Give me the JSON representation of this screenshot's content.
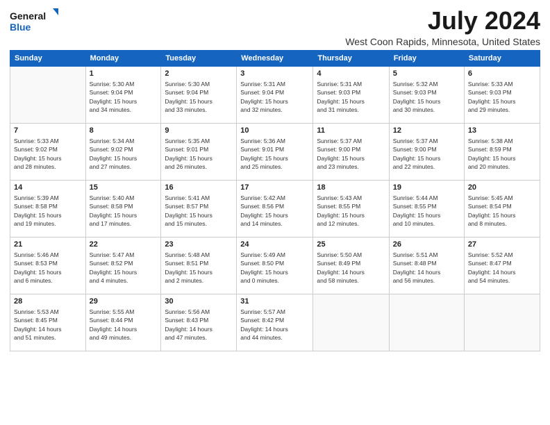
{
  "header": {
    "logo_line1": "General",
    "logo_line2": "Blue",
    "month_title": "July 2024",
    "location": "West Coon Rapids, Minnesota, United States"
  },
  "calendar": {
    "days_of_week": [
      "Sunday",
      "Monday",
      "Tuesday",
      "Wednesday",
      "Thursday",
      "Friday",
      "Saturday"
    ],
    "weeks": [
      [
        {
          "day": "",
          "info": ""
        },
        {
          "day": "1",
          "info": "Sunrise: 5:30 AM\nSunset: 9:04 PM\nDaylight: 15 hours\nand 34 minutes."
        },
        {
          "day": "2",
          "info": "Sunrise: 5:30 AM\nSunset: 9:04 PM\nDaylight: 15 hours\nand 33 minutes."
        },
        {
          "day": "3",
          "info": "Sunrise: 5:31 AM\nSunset: 9:04 PM\nDaylight: 15 hours\nand 32 minutes."
        },
        {
          "day": "4",
          "info": "Sunrise: 5:31 AM\nSunset: 9:03 PM\nDaylight: 15 hours\nand 31 minutes."
        },
        {
          "day": "5",
          "info": "Sunrise: 5:32 AM\nSunset: 9:03 PM\nDaylight: 15 hours\nand 30 minutes."
        },
        {
          "day": "6",
          "info": "Sunrise: 5:33 AM\nSunset: 9:03 PM\nDaylight: 15 hours\nand 29 minutes."
        }
      ],
      [
        {
          "day": "7",
          "info": "Sunrise: 5:33 AM\nSunset: 9:02 PM\nDaylight: 15 hours\nand 28 minutes."
        },
        {
          "day": "8",
          "info": "Sunrise: 5:34 AM\nSunset: 9:02 PM\nDaylight: 15 hours\nand 27 minutes."
        },
        {
          "day": "9",
          "info": "Sunrise: 5:35 AM\nSunset: 9:01 PM\nDaylight: 15 hours\nand 26 minutes."
        },
        {
          "day": "10",
          "info": "Sunrise: 5:36 AM\nSunset: 9:01 PM\nDaylight: 15 hours\nand 25 minutes."
        },
        {
          "day": "11",
          "info": "Sunrise: 5:37 AM\nSunset: 9:00 PM\nDaylight: 15 hours\nand 23 minutes."
        },
        {
          "day": "12",
          "info": "Sunrise: 5:37 AM\nSunset: 9:00 PM\nDaylight: 15 hours\nand 22 minutes."
        },
        {
          "day": "13",
          "info": "Sunrise: 5:38 AM\nSunset: 8:59 PM\nDaylight: 15 hours\nand 20 minutes."
        }
      ],
      [
        {
          "day": "14",
          "info": "Sunrise: 5:39 AM\nSunset: 8:58 PM\nDaylight: 15 hours\nand 19 minutes."
        },
        {
          "day": "15",
          "info": "Sunrise: 5:40 AM\nSunset: 8:58 PM\nDaylight: 15 hours\nand 17 minutes."
        },
        {
          "day": "16",
          "info": "Sunrise: 5:41 AM\nSunset: 8:57 PM\nDaylight: 15 hours\nand 15 minutes."
        },
        {
          "day": "17",
          "info": "Sunrise: 5:42 AM\nSunset: 8:56 PM\nDaylight: 15 hours\nand 14 minutes."
        },
        {
          "day": "18",
          "info": "Sunrise: 5:43 AM\nSunset: 8:55 PM\nDaylight: 15 hours\nand 12 minutes."
        },
        {
          "day": "19",
          "info": "Sunrise: 5:44 AM\nSunset: 8:55 PM\nDaylight: 15 hours\nand 10 minutes."
        },
        {
          "day": "20",
          "info": "Sunrise: 5:45 AM\nSunset: 8:54 PM\nDaylight: 15 hours\nand 8 minutes."
        }
      ],
      [
        {
          "day": "21",
          "info": "Sunrise: 5:46 AM\nSunset: 8:53 PM\nDaylight: 15 hours\nand 6 minutes."
        },
        {
          "day": "22",
          "info": "Sunrise: 5:47 AM\nSunset: 8:52 PM\nDaylight: 15 hours\nand 4 minutes."
        },
        {
          "day": "23",
          "info": "Sunrise: 5:48 AM\nSunset: 8:51 PM\nDaylight: 15 hours\nand 2 minutes."
        },
        {
          "day": "24",
          "info": "Sunrise: 5:49 AM\nSunset: 8:50 PM\nDaylight: 15 hours\nand 0 minutes."
        },
        {
          "day": "25",
          "info": "Sunrise: 5:50 AM\nSunset: 8:49 PM\nDaylight: 14 hours\nand 58 minutes."
        },
        {
          "day": "26",
          "info": "Sunrise: 5:51 AM\nSunset: 8:48 PM\nDaylight: 14 hours\nand 56 minutes."
        },
        {
          "day": "27",
          "info": "Sunrise: 5:52 AM\nSunset: 8:47 PM\nDaylight: 14 hours\nand 54 minutes."
        }
      ],
      [
        {
          "day": "28",
          "info": "Sunrise: 5:53 AM\nSunset: 8:45 PM\nDaylight: 14 hours\nand 51 minutes."
        },
        {
          "day": "29",
          "info": "Sunrise: 5:55 AM\nSunset: 8:44 PM\nDaylight: 14 hours\nand 49 minutes."
        },
        {
          "day": "30",
          "info": "Sunrise: 5:56 AM\nSunset: 8:43 PM\nDaylight: 14 hours\nand 47 minutes."
        },
        {
          "day": "31",
          "info": "Sunrise: 5:57 AM\nSunset: 8:42 PM\nDaylight: 14 hours\nand 44 minutes."
        },
        {
          "day": "",
          "info": ""
        },
        {
          "day": "",
          "info": ""
        },
        {
          "day": "",
          "info": ""
        }
      ]
    ]
  }
}
